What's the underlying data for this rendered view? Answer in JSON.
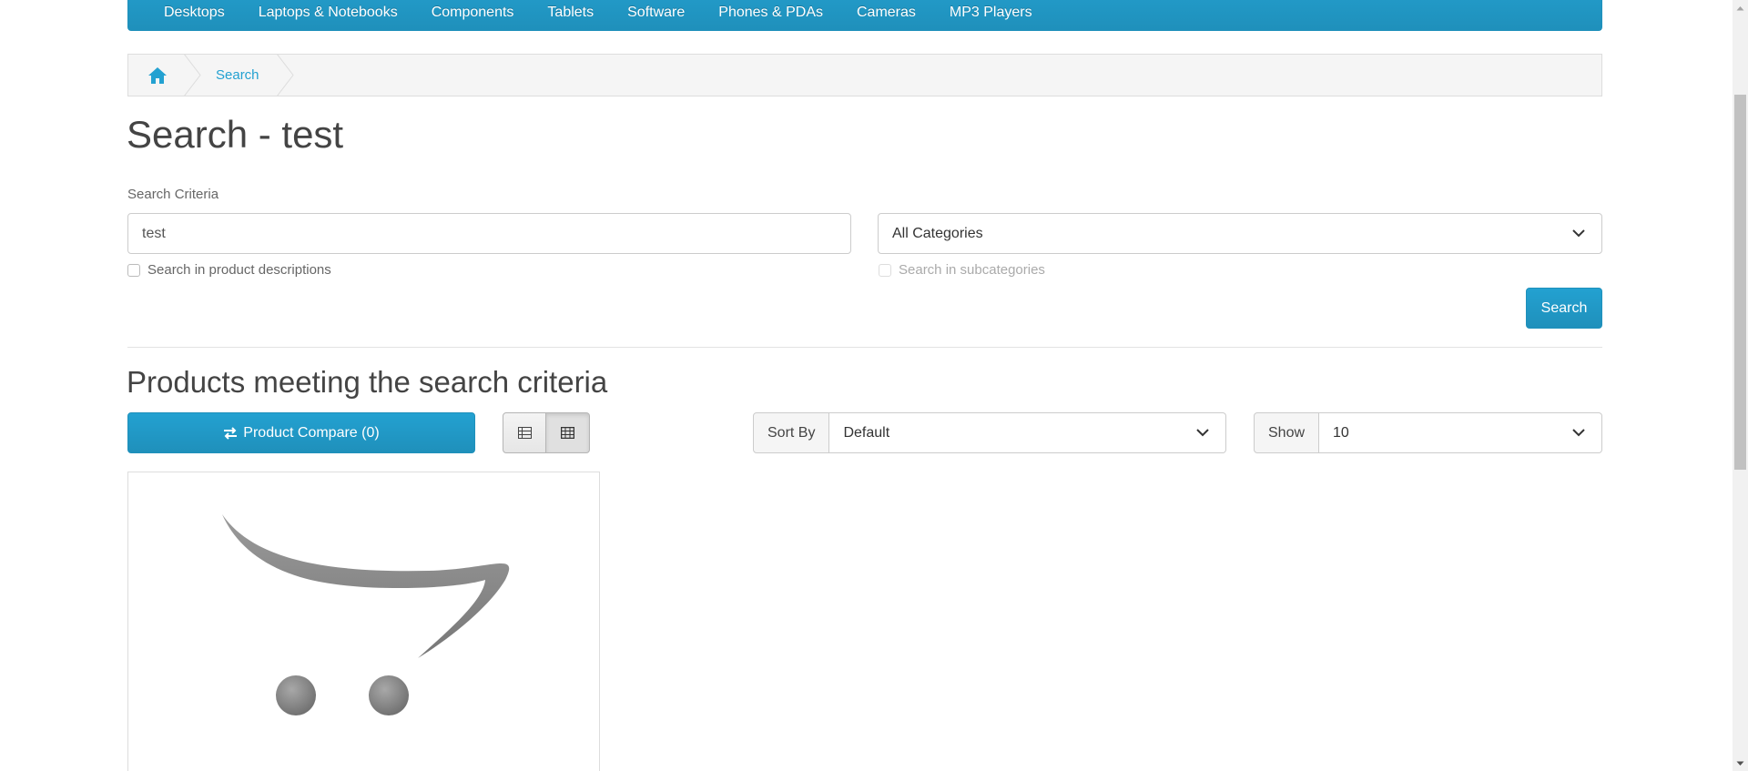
{
  "nav": {
    "items": [
      "Desktops",
      "Laptops & Notebooks",
      "Components",
      "Tablets",
      "Software",
      "Phones & PDAs",
      "Cameras",
      "MP3 Players"
    ]
  },
  "breadcrumb": {
    "home_icon": "home-icon",
    "current": "Search"
  },
  "page": {
    "title": "Search - test"
  },
  "search_form": {
    "criteria_label": "Search Criteria",
    "keyword_value": "test",
    "category_selected": "All Categories",
    "desc_checkbox_label": "Search in product descriptions",
    "subcat_checkbox_label": "Search in subcategories",
    "search_button": "Search"
  },
  "results": {
    "heading": "Products meeting the search criteria",
    "compare_button": "Product Compare (0)",
    "compare_icon": "exchange-icon",
    "view_list_icon": "list-view-icon",
    "view_grid_icon": "grid-view-icon",
    "sort_label": "Sort By",
    "sort_value": "Default",
    "show_label": "Show",
    "show_value": "10"
  },
  "colors": {
    "accent": "#229ac8",
    "link": "#23a1d1",
    "breadcrumb_bg": "#f5f5f5",
    "text": "#444444"
  }
}
